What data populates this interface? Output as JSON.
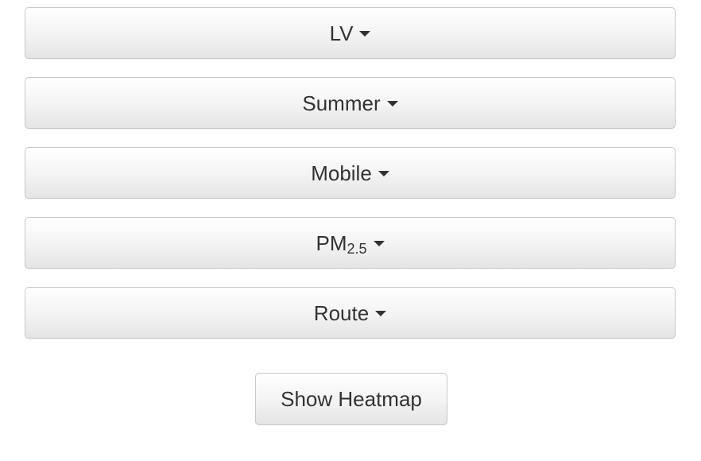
{
  "dropdowns": [
    {
      "label": "LV"
    },
    {
      "label": "Summer"
    },
    {
      "label": "Mobile"
    },
    {
      "label": "PM",
      "sub": "2.5"
    },
    {
      "label": "Route"
    }
  ],
  "action": {
    "label": "Show Heatmap"
  },
  "colors": {
    "text": "#333333",
    "border": "#c8c8c8"
  }
}
